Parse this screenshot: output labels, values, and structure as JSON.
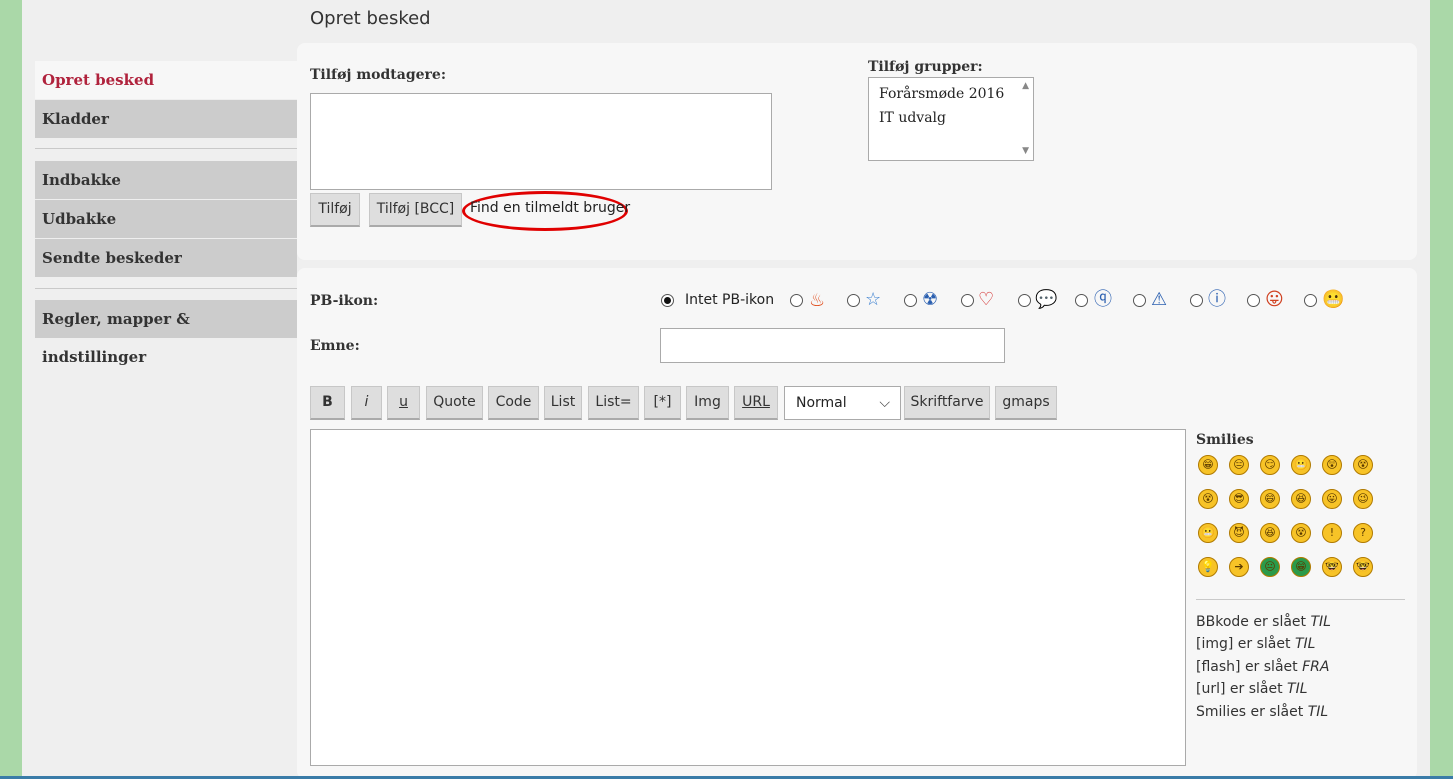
{
  "page_title": "Opret besked",
  "sidebar": {
    "items": [
      {
        "label": "Opret besked"
      },
      {
        "label": "Kladder"
      },
      {
        "label": "Indbakke"
      },
      {
        "label": "Udbakke"
      },
      {
        "label": "Sendte beskeder"
      },
      {
        "label": "Regler, mapper & indstillinger"
      }
    ]
  },
  "recipients": {
    "label": "Tilføj modtagere:",
    "add_button": "Tilføj",
    "add_bcc_button": "Tilføj [BCC]",
    "find_link": "Find en tilmeldt bruger"
  },
  "groups": {
    "label": "Tilføj grupper:",
    "options": [
      "Forårsmøde 2016",
      "IT udvalg"
    ]
  },
  "pb_icon": {
    "label": "PB-ikon:",
    "none_label": "Intet PB-ikon",
    "icons": [
      "fire-icon",
      "star-icon",
      "radioactive-icon",
      "heart-icon",
      "speech-bubble-icon",
      "question-icon",
      "warning-icon",
      "info-icon",
      "smiley-tongue-icon",
      "smiley-grin-icon"
    ]
  },
  "subject": {
    "label": "Emne:",
    "value": ""
  },
  "toolbar": {
    "bold": "B",
    "italic": "i",
    "underline": "u",
    "quote": "Quote",
    "code": "Code",
    "list": "List",
    "list_eq": "List=",
    "list_item": "[*]",
    "img": "Img",
    "url": "URL",
    "font_size": "Normal",
    "font_color": "Skriftfarve",
    "gmaps": "gmaps"
  },
  "smilies": {
    "title": "Smilies",
    "glyphs": [
      "😁",
      "😑",
      "😏",
      "😬",
      "😲",
      "😵",
      "😵",
      "😎",
      "😄",
      "😆",
      "😛",
      "😉",
      "😬",
      "😈",
      "😆",
      "😵",
      "!",
      "?",
      "💡",
      "➔",
      "😐",
      "😁",
      "🤓",
      "🤓"
    ]
  },
  "status": [
    {
      "text": "BBkode er slået ",
      "state": "TIL"
    },
    {
      "text": "[img] er slået ",
      "state": "TIL"
    },
    {
      "text": "[flash] er slået ",
      "state": "FRA"
    },
    {
      "text": "[url] er slået ",
      "state": "TIL"
    },
    {
      "text": "Smilies er slået ",
      "state": "TIL"
    }
  ]
}
